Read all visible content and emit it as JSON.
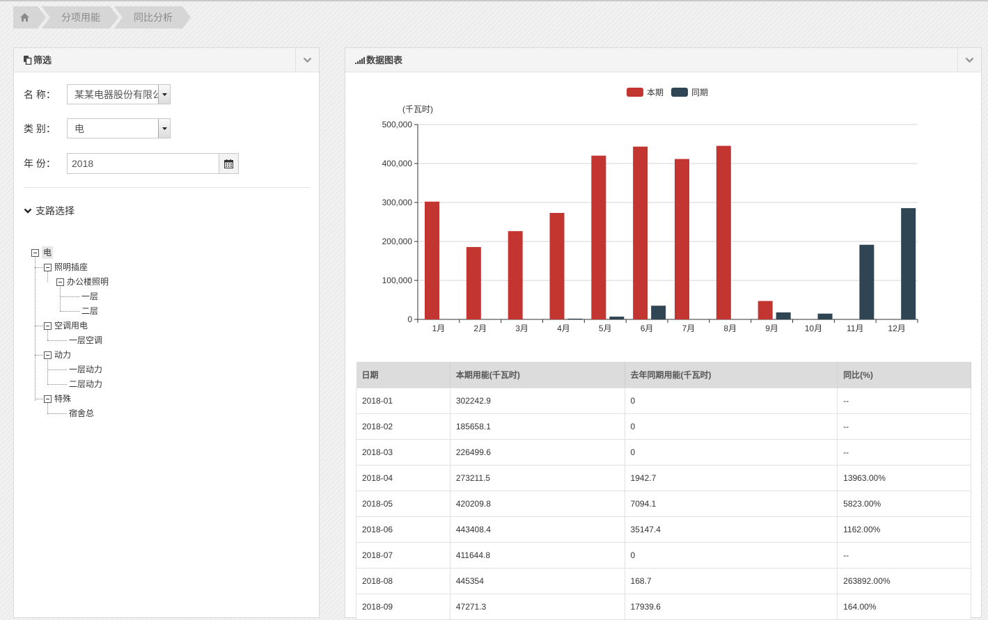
{
  "breadcrumb": {
    "home_icon": "home-icon",
    "items": [
      "分项用能",
      "同比分析"
    ]
  },
  "filter_panel": {
    "title": "筛选",
    "icon": "copy-icon",
    "name_label": "名 称：",
    "name_value": "某某电器股份有限公司",
    "category_label": "类 别：",
    "category_value": "电",
    "year_label": "年 份：",
    "year_value": "2018",
    "branch_title": "支路选择"
  },
  "tree": {
    "root": "电",
    "n1": "照明插座",
    "n1a": "办公楼照明",
    "n1a1": "一层",
    "n1a2": "二层",
    "n2": "空调用电",
    "n2a": "一层空调",
    "n3": "动力",
    "n3a": "一层动力",
    "n3b": "二层动力",
    "n4": "特殊",
    "n4a": "宿舍总"
  },
  "chart_panel": {
    "title": "数据图表",
    "icon": "signal-icon"
  },
  "chart_data": {
    "type": "bar",
    "categories": [
      "1月",
      "2月",
      "3月",
      "4月",
      "5月",
      "6月",
      "7月",
      "8月",
      "9月",
      "10月",
      "11月",
      "12月"
    ],
    "series": [
      {
        "name": "本期",
        "color": "#c23531",
        "values": [
          302242.9,
          185658.1,
          226499.6,
          273211.5,
          420209.8,
          443408.4,
          411644.8,
          445354,
          47271.3,
          0,
          0,
          0
        ]
      },
      {
        "name": "同期",
        "color": "#2f4554",
        "values": [
          0,
          0,
          0,
          1942.7,
          7094.1,
          35147.4,
          0,
          168.7,
          17939.6,
          14800,
          191500,
          285500
        ]
      }
    ],
    "ylabel": "(千瓦时)",
    "ylim": [
      0,
      500000
    ],
    "yticks": [
      0,
      100000,
      200000,
      300000,
      400000,
      500000
    ],
    "ytick_labels": [
      "0",
      "100,000",
      "200,000",
      "300,000",
      "400,000",
      "500,000"
    ],
    "grid": true,
    "legend": "top-center"
  },
  "table": {
    "headers": [
      "日期",
      "本期用能(千瓦时)",
      "去年同期用能(千瓦时)",
      "同比(%)"
    ],
    "rows": [
      [
        "2018-01",
        "302242.9",
        "0",
        "--"
      ],
      [
        "2018-02",
        "185658.1",
        "0",
        "--"
      ],
      [
        "2018-03",
        "226499.6",
        "0",
        "--"
      ],
      [
        "2018-04",
        "273211.5",
        "1942.7",
        "13963.00%"
      ],
      [
        "2018-05",
        "420209.8",
        "7094.1",
        "5823.00%"
      ],
      [
        "2018-06",
        "443408.4",
        "35147.4",
        "1162.00%"
      ],
      [
        "2018-07",
        "411644.8",
        "0",
        "--"
      ],
      [
        "2018-08",
        "445354",
        "168.7",
        "263892.00%"
      ],
      [
        "2018-09",
        "47271.3",
        "17939.6",
        "164.00%"
      ]
    ]
  }
}
